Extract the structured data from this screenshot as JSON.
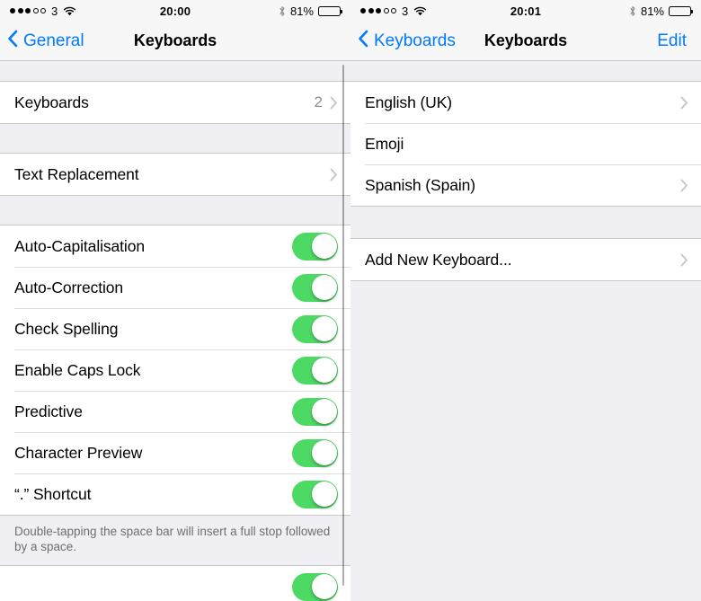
{
  "left_panel": {
    "status_bar": {
      "signal_filled": 3,
      "signal_hollow": 2,
      "carrier": "3",
      "wifi_icon": "wifi-icon",
      "time": "20:00",
      "bluetooth_icon": "bluetooth-icon",
      "battery_percent": "81%",
      "battery_level": 81
    },
    "nav": {
      "back_label": "General",
      "back_icon": "chevron-left-icon",
      "title": "Keyboards"
    },
    "groups": [
      {
        "rows": [
          {
            "label": "Keyboards",
            "detail": "2",
            "accessory": "chevron"
          }
        ]
      },
      {
        "rows": [
          {
            "label": "Text Replacement",
            "detail": "",
            "accessory": "chevron"
          }
        ]
      },
      {
        "rows": [
          {
            "label": "Auto-Capitalisation",
            "accessory": "switch",
            "switch_on": true
          },
          {
            "label": "Auto-Correction",
            "accessory": "switch",
            "switch_on": true
          },
          {
            "label": "Check Spelling",
            "accessory": "switch",
            "switch_on": true
          },
          {
            "label": "Enable Caps Lock",
            "accessory": "switch",
            "switch_on": true
          },
          {
            "label": "Predictive",
            "accessory": "switch",
            "switch_on": true
          },
          {
            "label": "Character Preview",
            "accessory": "switch",
            "switch_on": true
          },
          {
            "label": "“.” Shortcut",
            "accessory": "switch",
            "switch_on": true
          }
        ]
      }
    ],
    "footer_note": "Double-tapping the space bar will insert a full stop followed by a space.",
    "partial_row": {
      "label": "",
      "accessory": "switch",
      "switch_on": true
    }
  },
  "right_panel": {
    "status_bar": {
      "signal_filled": 3,
      "signal_hollow": 2,
      "carrier": "3",
      "wifi_icon": "wifi-icon",
      "time": "20:01",
      "bluetooth_icon": "bluetooth-icon",
      "battery_percent": "81%",
      "battery_level": 81
    },
    "nav": {
      "back_label": "Keyboards",
      "back_icon": "chevron-left-icon",
      "title": "Keyboards",
      "edit_label": "Edit"
    },
    "groups": [
      {
        "rows": [
          {
            "label": "English (UK)",
            "accessory": "chevron"
          },
          {
            "label": "Emoji",
            "accessory": "none"
          },
          {
            "label": "Spanish (Spain)",
            "accessory": "chevron"
          }
        ]
      },
      {
        "rows": [
          {
            "label": "Add New Keyboard...",
            "accessory": "chevron"
          }
        ]
      }
    ]
  },
  "colors": {
    "accent_blue": "#007AFF",
    "switch_green": "#4CD964",
    "background": "#EFEFF4",
    "bar": "#F7F7F7",
    "separator": "#C8C7CC",
    "detail_gray": "#8E8E93",
    "footer_gray": "#6D6D72"
  }
}
